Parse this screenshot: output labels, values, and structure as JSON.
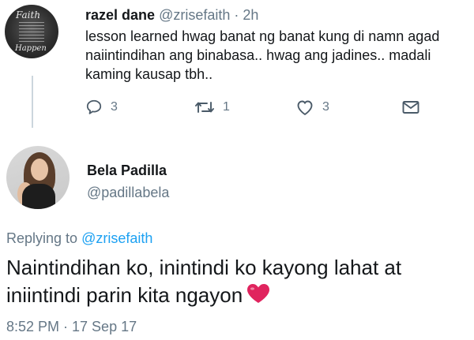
{
  "tweet1": {
    "name": "razel dane",
    "handle": "@zrisefaith",
    "separator": "·",
    "time": "2h",
    "avatar_text_top": "Faith",
    "avatar_text_bottom": "Happen",
    "body": "lesson learned hwag banat ng banat kung di namn agad naiintindihan ang binabasa.. hwag ang jadines.. madali kaming kausap tbh..",
    "actions": [
      {
        "icon": "reply-icon",
        "count": "3"
      },
      {
        "icon": "retweet-icon",
        "count": "1"
      },
      {
        "icon": "like-icon",
        "count": "3"
      },
      {
        "icon": "message-icon",
        "count": ""
      }
    ]
  },
  "tweet2": {
    "name": "Bela Padilla",
    "handle": "@padillabela",
    "replying_prefix": "Replying to ",
    "replying_mention": "@zrisefaith",
    "body": "Naintindihan ko, inintindi ko kayong lahat at iniintindi parin kita ngayon",
    "emoji": "heart",
    "timestamp": "8:52 PM · 17 Sep 17"
  },
  "colors": {
    "text": "#14171a",
    "muted": "#657786",
    "link": "#1da1f2",
    "heart": "#e0245e"
  }
}
